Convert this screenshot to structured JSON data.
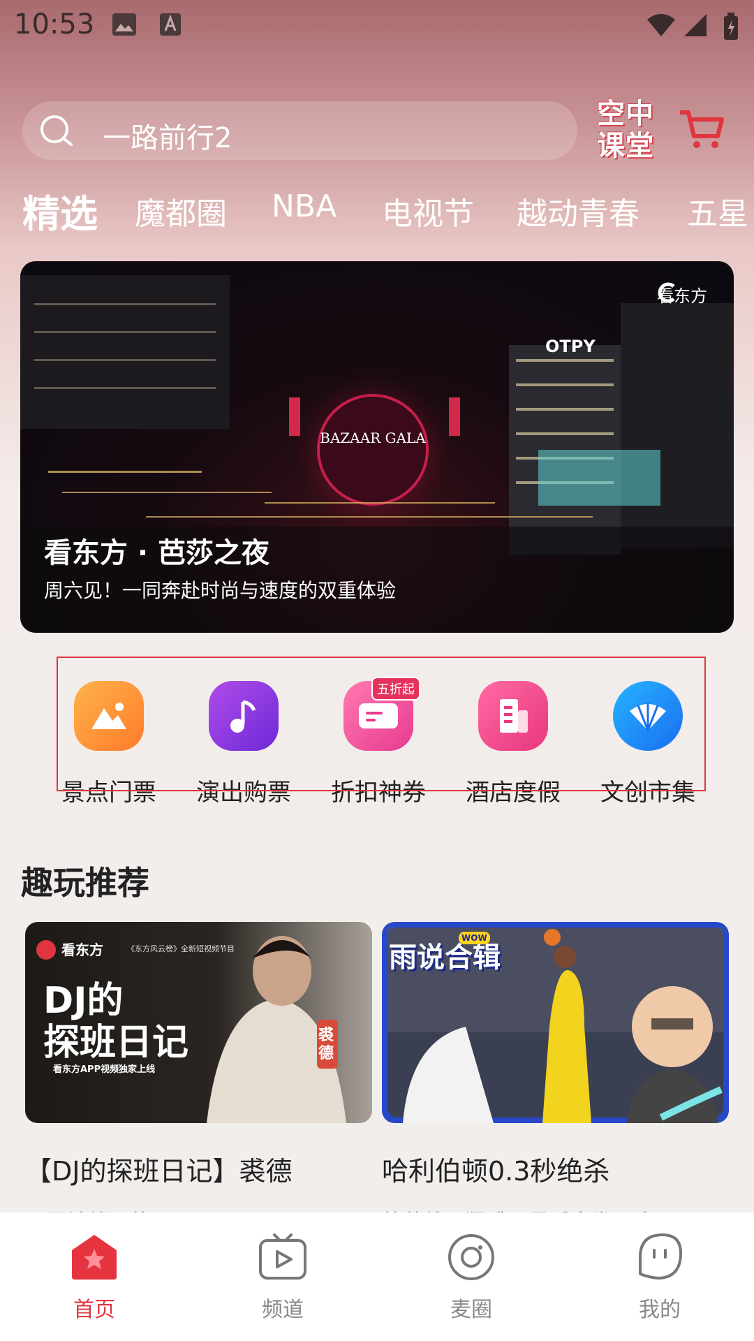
{
  "status_bar": {
    "time": "10:53"
  },
  "search": {
    "text": "一路前行2"
  },
  "promo_logo": {
    "line1": "空中",
    "line2": "课堂"
  },
  "tabs": [
    {
      "label": "精选",
      "active": true
    },
    {
      "label": "魔都圈"
    },
    {
      "label": "NBA"
    },
    {
      "label": "电视节"
    },
    {
      "label": "越动青春"
    },
    {
      "label": "五星"
    }
  ],
  "banner": {
    "brand": "看东方",
    "title": "看东方 · 芭莎之夜",
    "subtitle": "周六见！一同奔赴时尚与速度的双重体验",
    "sign_text": "BAZAAR GALA"
  },
  "quick_entries": [
    {
      "label": "景点门票",
      "icon": "mountain-photo-icon"
    },
    {
      "label": "演出购票",
      "icon": "music-note-icon"
    },
    {
      "label": "折扣神券",
      "icon": "ticket-coupon-icon",
      "badge": "五折起"
    },
    {
      "label": "酒店度假",
      "icon": "building-icon"
    },
    {
      "label": "文创市集",
      "icon": "fan-icon"
    }
  ],
  "section": {
    "title": "趣玩推荐"
  },
  "cards": [
    {
      "title": "【DJ的探班日记】裘德",
      "subtitle": "又是被催更的一天！",
      "thumb_brand": "看东方",
      "thumb_heading_1": "DJ的",
      "thumb_heading_2": "探班日记",
      "thumb_caption": "看东方APP视频独家上线",
      "thumb_tag": "《东方风云榜》全新短视频节目",
      "thumb_name": "裘德"
    },
    {
      "title": "哈利伯顿0.3秒绝杀",
      "subtitle": "静若处子猛跳，最后突发恶疾",
      "thumb_heading": "雨说合辑",
      "thumb_badge": "WOW"
    }
  ],
  "bottom_nav": [
    {
      "label": "首页",
      "active": true
    },
    {
      "label": "频道"
    },
    {
      "label": "麦圈"
    },
    {
      "label": "我的"
    }
  ],
  "colors": {
    "accent": "#e0353f",
    "inactive": "#888888"
  }
}
